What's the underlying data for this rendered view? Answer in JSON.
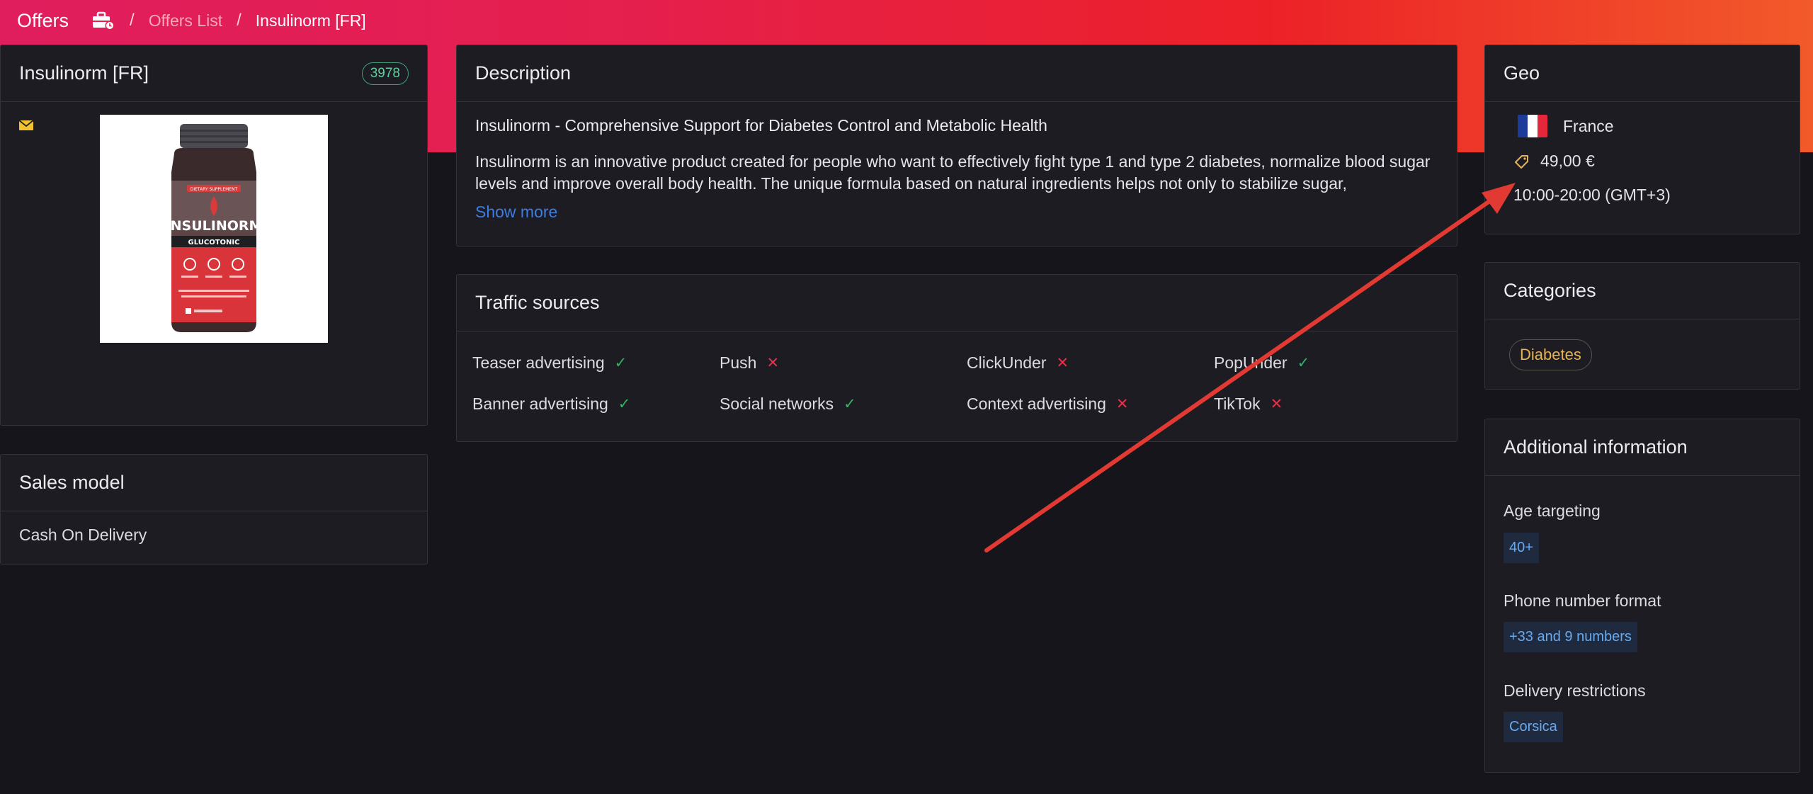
{
  "header": {
    "section_title": "Offers",
    "breadcrumb": {
      "separator": "/",
      "link": "Offers List",
      "current": "Insulinorm [FR]"
    },
    "gradient_colors": [
      "#e01e5e",
      "#ec2128",
      "#f25a2a"
    ]
  },
  "product": {
    "title": "Insulinorm [FR]",
    "id": "3978",
    "image": {
      "brand": "INSULINORM",
      "subtitle": "GLUCOTONIC",
      "top_label": "DIETARY SUPPLEMENT"
    }
  },
  "sales_model": {
    "title": "Sales model",
    "value": "Cash On Delivery"
  },
  "description": {
    "title": "Description",
    "headline": "Insulinorm - Comprehensive Support for Diabetes Control and Metabolic Health",
    "text": "Insulinorm is an innovative product created for people who want to effectively fight type 1 and type 2 diabetes, normalize blood sugar levels and improve overall body health. The unique formula based on natural ingredients helps not only to stabilize sugar,",
    "show_more": "Show more"
  },
  "traffic": {
    "title": "Traffic sources",
    "sources": [
      {
        "label": "Teaser advertising",
        "allowed": true,
        "mark": "✓"
      },
      {
        "label": "Push",
        "allowed": false,
        "mark": "✕"
      },
      {
        "label": "ClickUnder",
        "allowed": false,
        "mark": "✕"
      },
      {
        "label": "PopUnder",
        "allowed": true,
        "mark": "✓"
      },
      {
        "label": "Banner advertising",
        "allowed": true,
        "mark": "✓"
      },
      {
        "label": "Social networks",
        "allowed": true,
        "mark": "✓"
      },
      {
        "label": "Context advertising",
        "allowed": false,
        "mark": "✕"
      },
      {
        "label": "TikTok",
        "allowed": false,
        "mark": "✕"
      }
    ]
  },
  "geo": {
    "title": "Geo",
    "country": "France",
    "price": "49,00 €",
    "hours": "10:00-20:00 (GMT+3)"
  },
  "categories": {
    "title": "Categories",
    "items": [
      "Diabetes"
    ]
  },
  "additional": {
    "title": "Additional information",
    "age_label": "Age targeting",
    "age_value": "40+",
    "phone_label": "Phone number format",
    "phone_value": "+33 and 9 numbers",
    "delivery_label": "Delivery restrictions",
    "delivery_value": "Corsica"
  },
  "annotation": {
    "color": "#e23a33"
  }
}
